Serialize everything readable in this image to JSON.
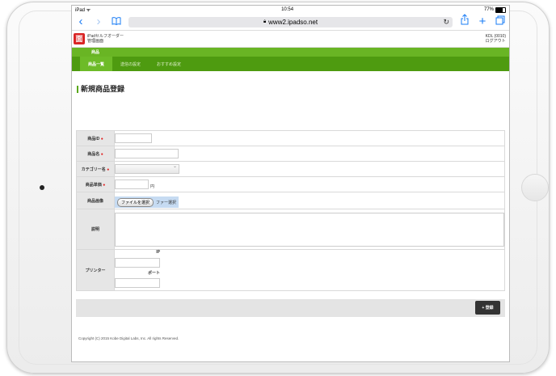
{
  "device": {
    "status_left": "iPad ᯤ",
    "time": "10:54",
    "battery": "77%"
  },
  "browser": {
    "url": "www2.ipadso.net",
    "back_icon": "chevron-left",
    "forward_icon": "chevron-right",
    "bookmarks_icon": "book",
    "reload_icon": "reload",
    "share_icon": "share",
    "new_tab_icon": "plus",
    "tabs_icon": "tabs"
  },
  "site": {
    "logo_glyph": "面",
    "brand_line1": "iPadセルフオーダー",
    "brand_line2": "管理画面",
    "user_line1": "KDL (0010)",
    "user_line2": "ログアウト"
  },
  "nav": {
    "top_item": "商品",
    "tabs": [
      {
        "label": "商品一覧",
        "active": true
      },
      {
        "label": "送信の設定",
        "active": false
      },
      {
        "label": "おすすめ設定",
        "active": false
      }
    ]
  },
  "form": {
    "title": "新規商品登録",
    "required_mark": "●",
    "fields": {
      "product_id": "商品ID",
      "product_name": "商品名",
      "category": "カテゴリー名",
      "price": "商品単価",
      "price_unit": "円",
      "image": "商品画像",
      "file_button": "ファイルを選択",
      "file_status": "ファー選択",
      "description": "説明",
      "printer": "プリンター",
      "printer_ip": "IP",
      "printer_port": "ポート"
    }
  },
  "actions": {
    "register_label": "登録",
    "register_icon": "+"
  },
  "footer": {
    "copyright": "Copyright (C) 2015 Kobe Digital Labs, Inc. All rights Reserved."
  },
  "colors": {
    "nav_green": "#69b524",
    "subnav_green": "#4e9b10",
    "logo_red": "#d92424",
    "ios_blue": "#1a7cf5"
  }
}
